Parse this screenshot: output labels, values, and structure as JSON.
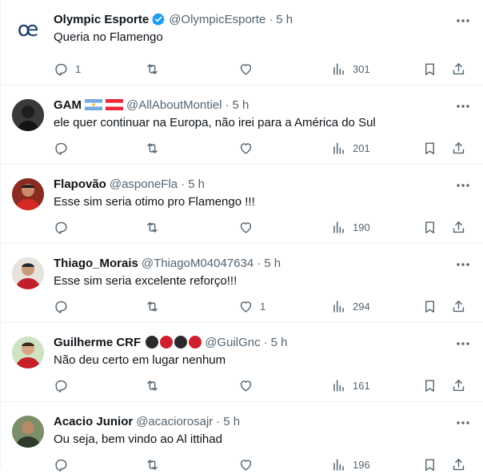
{
  "tweets": [
    {
      "name": "Olympic Esporte",
      "handle": "@OlympicEsporte",
      "time": "5 h",
      "text": "Queria no Flamengo",
      "reply_count": "1",
      "retweet_count": "",
      "like_count": "",
      "views": "301",
      "verified": true,
      "logo_text": "œ"
    },
    {
      "name": "GAM",
      "handle": "@AllAboutMontiel",
      "time": "5 h",
      "text": "ele quer continuar na Europa, não irei para a América do Sul",
      "reply_count": "",
      "retweet_count": "",
      "like_count": "",
      "views": "201"
    },
    {
      "name": "Flapovão",
      "handle": "@asponeFla",
      "time": "5 h",
      "text": "Esse sim seria otimo pro Flamengo !!!",
      "reply_count": "",
      "retweet_count": "",
      "like_count": "",
      "views": "190"
    },
    {
      "name": "Thiago_Morais",
      "handle": "@ThiagoM04047634",
      "time": "5 h",
      "text": "Esse sim seria excelente reforço!!!",
      "reply_count": "",
      "retweet_count": "",
      "like_count": "1",
      "views": "294"
    },
    {
      "name": "Guilherme CRF",
      "handle": "@GuilGnc",
      "time": "5 h",
      "text": "Não deu certo em lugar nenhum",
      "reply_count": "",
      "retweet_count": "",
      "like_count": "",
      "views": "161"
    },
    {
      "name": "Acacio Junior",
      "handle": "@acaciorosajr",
      "time": "5 h",
      "text": "Ou seja, bem vindo ao Al ittihad",
      "reply_count": "",
      "retweet_count": "",
      "like_count": "",
      "views": "196"
    }
  ],
  "colors": {
    "text_primary": "#0f1419",
    "text_secondary": "#536471",
    "verified_blue": "#1d9bf0",
    "divider": "#eff3f4",
    "flamengo_red": "#d01f2c",
    "flamengo_black": "#2a2a2a"
  }
}
